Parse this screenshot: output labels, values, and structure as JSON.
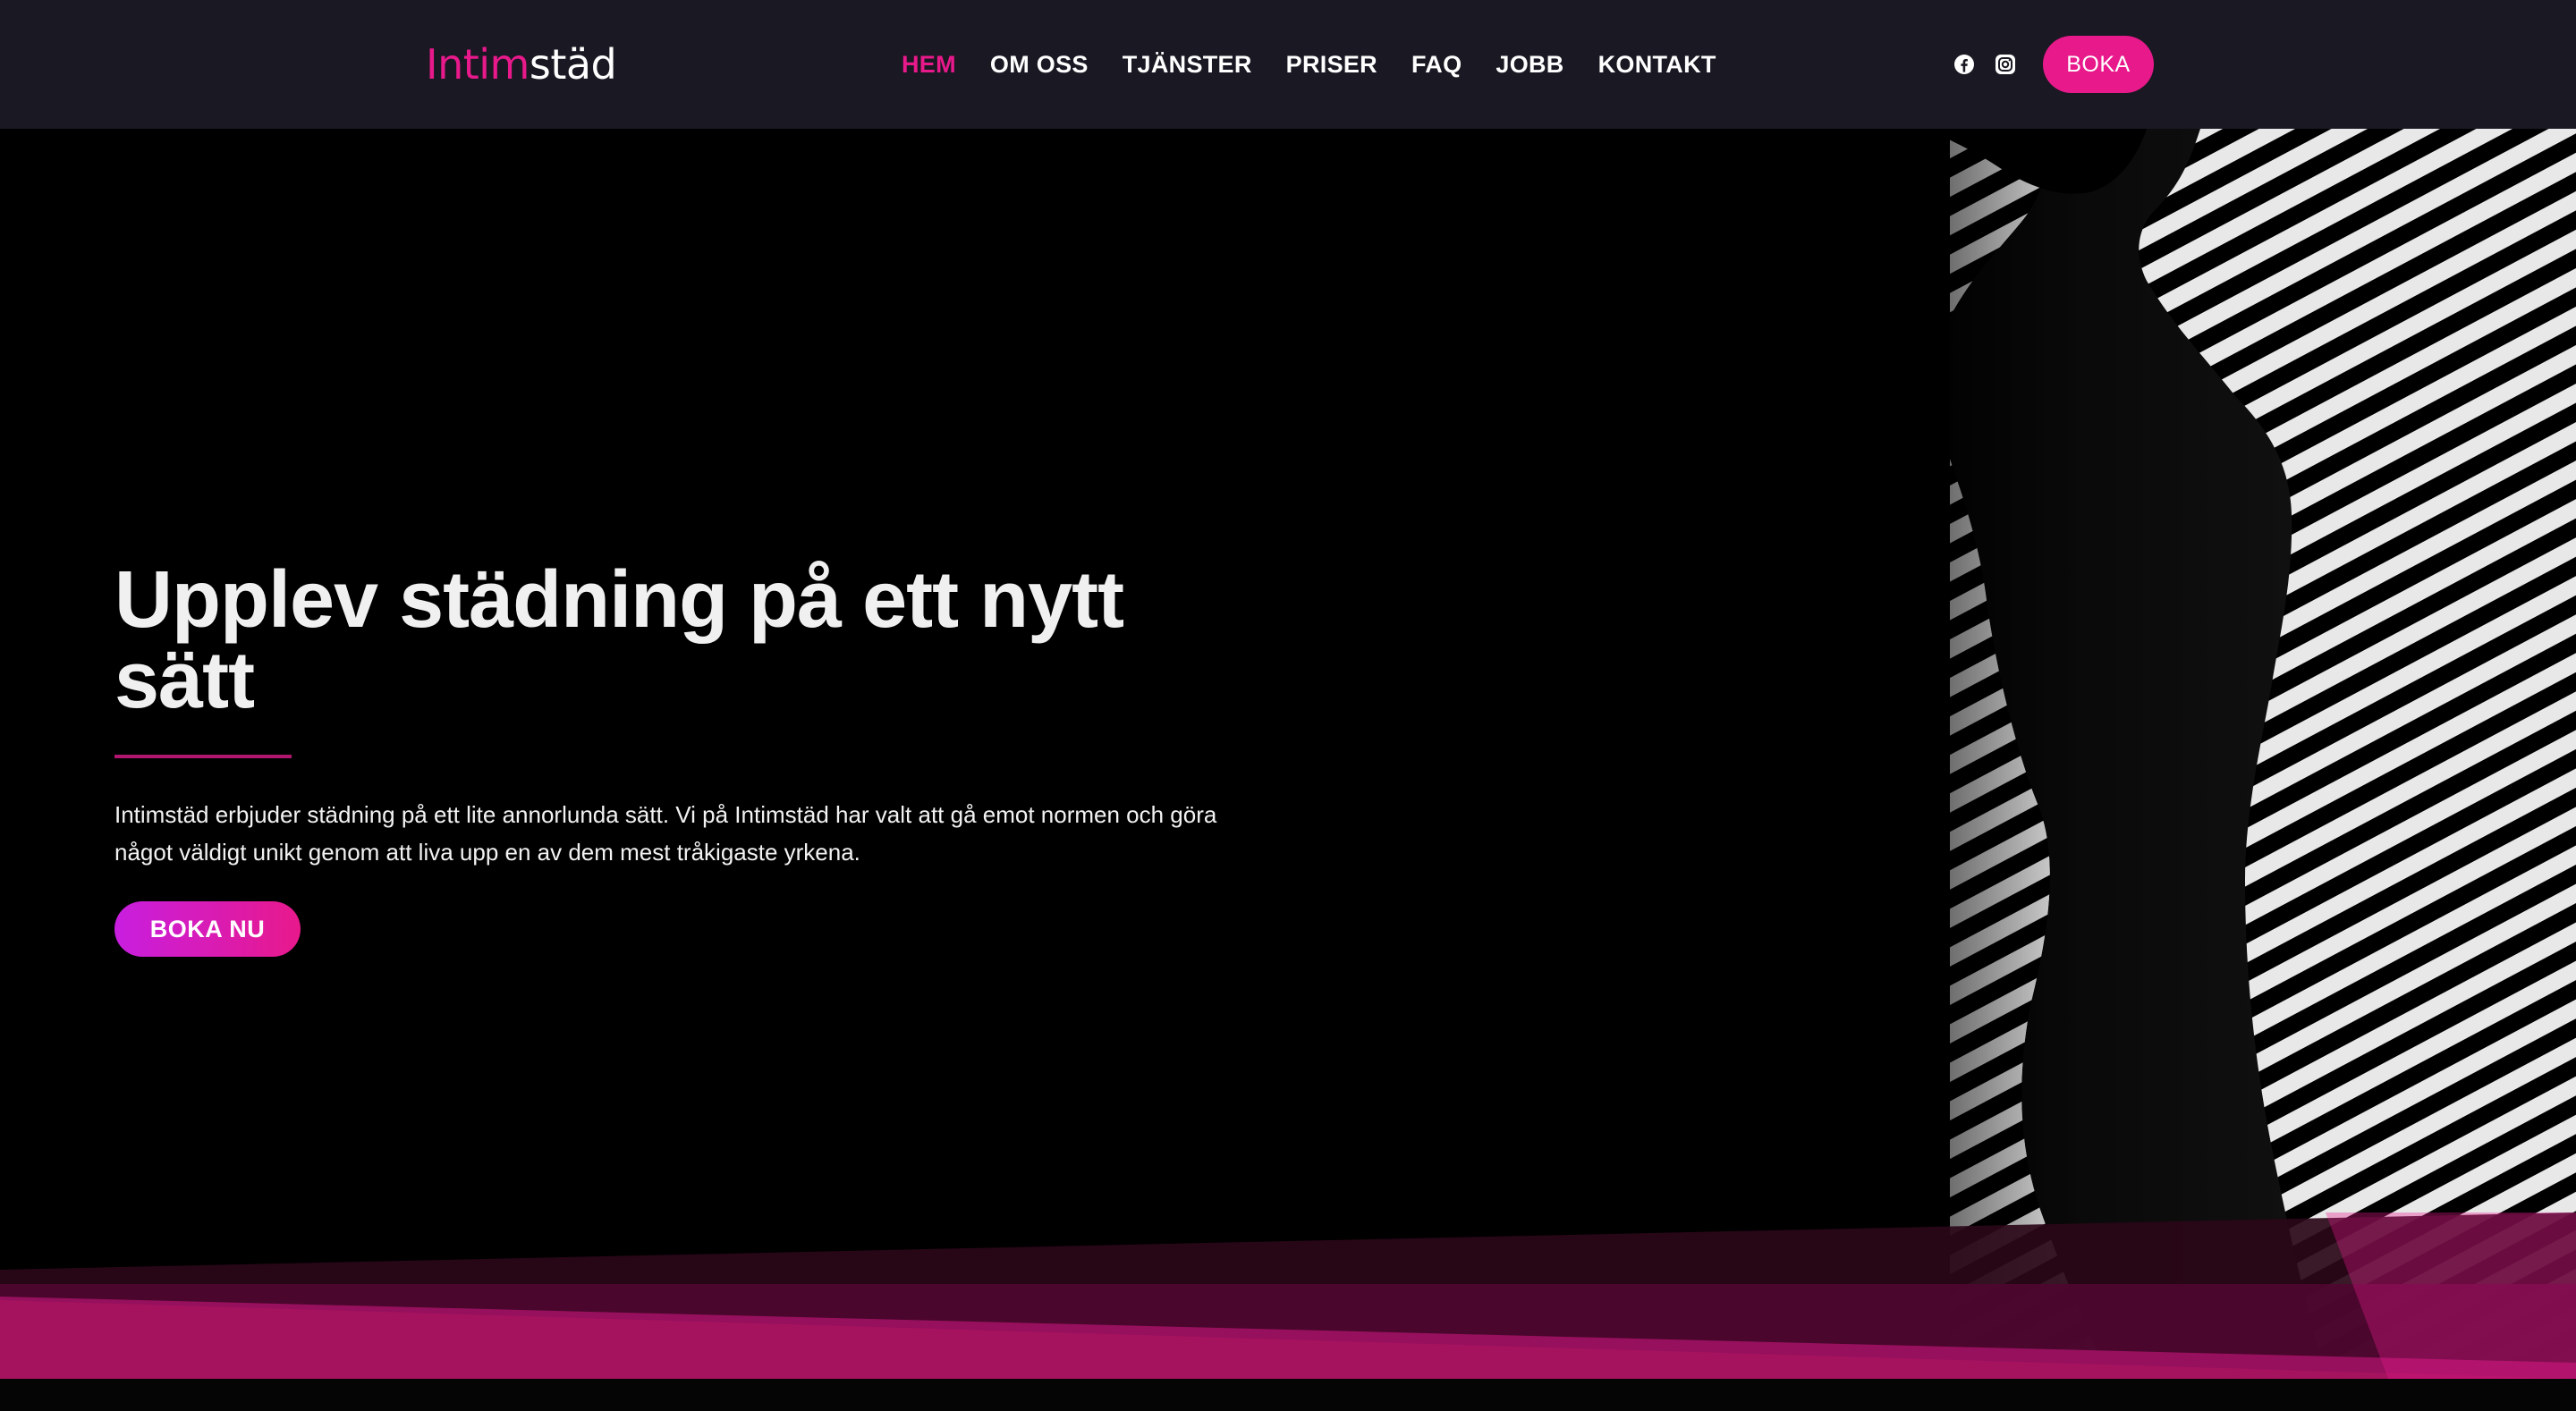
{
  "brand": {
    "logo_part1": "Intim",
    "logo_part2": "städ",
    "accent_color": "#e8198b",
    "navbar_bg": "#1a1822"
  },
  "nav": {
    "items": [
      {
        "label": "HEM",
        "active": true
      },
      {
        "label": "OM OSS",
        "active": false
      },
      {
        "label": "TJÄNSTER",
        "active": false
      },
      {
        "label": "PRISER",
        "active": false
      },
      {
        "label": "FAQ",
        "active": false
      },
      {
        "label": "JOBB",
        "active": false
      },
      {
        "label": "KONTAKT",
        "active": false
      }
    ],
    "social": [
      {
        "icon": "facebook-icon"
      },
      {
        "icon": "instagram-icon"
      }
    ],
    "book_label": "BOKA"
  },
  "hero": {
    "title": "Upplev städning på ett nytt sätt",
    "text": "Intimstäd erbjuder städning på ett lite annorlunda sätt. Vi på Intimstäd har valt att gå emot normen och göra något väldigt unikt genom att liva upp en av dem mest tråkigaste yrkena.",
    "cta_label": "BOKA NU",
    "image": "silhouette-with-striped-light-image"
  }
}
